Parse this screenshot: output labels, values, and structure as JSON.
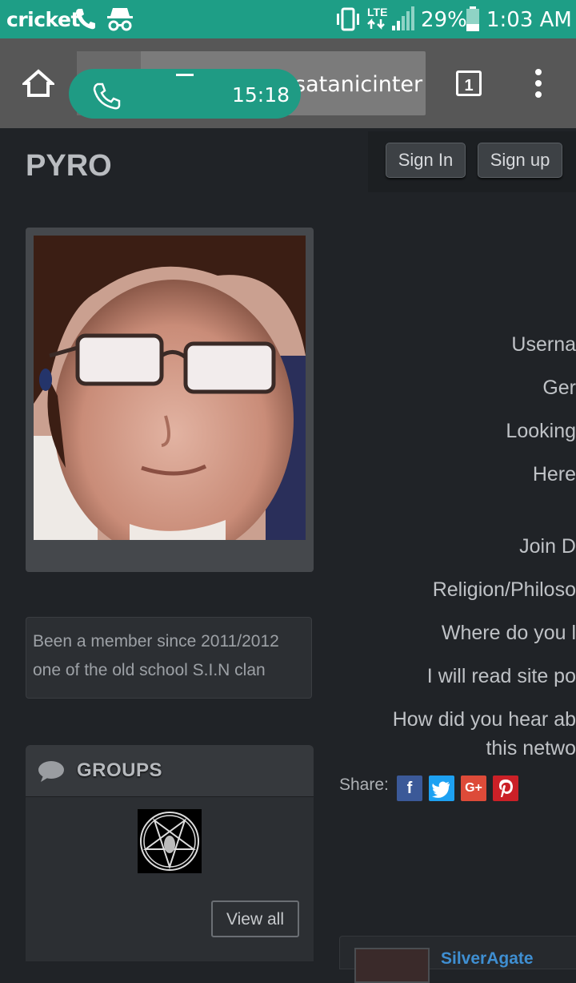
{
  "status_bar": {
    "carrier": "cricket",
    "network": "LTE",
    "battery": "29%",
    "time": "1:03 AM"
  },
  "browser": {
    "url_fragment": "satanicinter",
    "tab_count": "1"
  },
  "call_overlay": {
    "duration": "15:18"
  },
  "profile": {
    "name": "PYRO",
    "bio": "Been a member since 2011/2012 one of the old school S.I.N clan"
  },
  "auth": {
    "sign_in": "Sign In",
    "sign_up": "Sign up"
  },
  "groups": {
    "title": "GROUPS",
    "view_all": "View all"
  },
  "profile_fields": [
    "Userna",
    "Ger",
    "Looking",
    "Here",
    "Join D",
    "Religion/Philoso",
    "Where do you l",
    "I will read site po",
    "How did you hear ab",
    "this netwo"
  ],
  "share": {
    "label": "Share:",
    "facebook": "f",
    "google": "G+"
  },
  "member_card": {
    "name": "SilverAgate"
  },
  "colors": {
    "status_bar": "#1e9e86",
    "page_bg": "#202327",
    "link": "#3f8fd2",
    "facebook": "#3b5998",
    "twitter": "#1da1f2",
    "google": "#dd4b39",
    "pinterest": "#cb2027"
  }
}
